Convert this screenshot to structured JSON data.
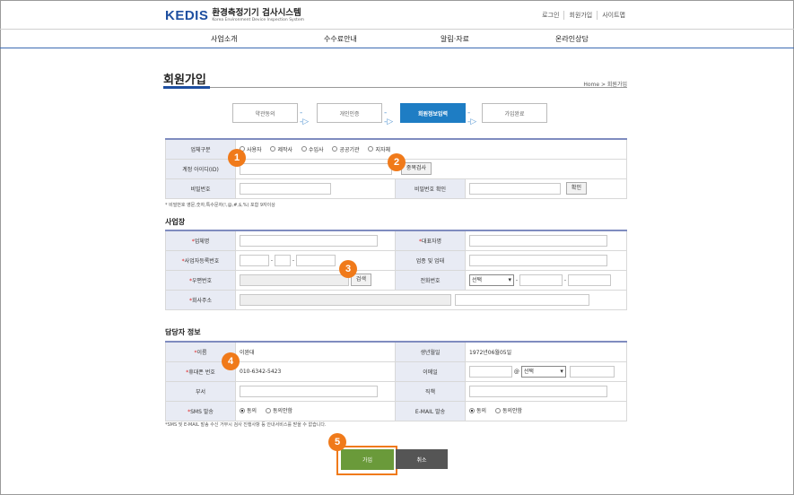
{
  "header": {
    "logo_mark": "KEDIS",
    "logo_kr": "환경측정기기 검사시스템",
    "logo_en": "Korea Environment Device Inspection System",
    "util": [
      "로그인",
      "회원가입",
      "사이트맵"
    ]
  },
  "gnb": [
    "사업소개",
    "수수료안내",
    "알림·자료",
    "온라인상담"
  ],
  "page": {
    "title": "회원가입",
    "breadcrumb": "Home  >  회원가입"
  },
  "steps": [
    "약관동의",
    "개인인증",
    "회원정보입력",
    "가입완료"
  ],
  "account": {
    "biz_type_label": "업체구분",
    "biz_types": [
      "사용자",
      "제작사",
      "수입사",
      "공공기관",
      "지자체"
    ],
    "id_label": "계정 아이디(ID)",
    "dup_check": "중복검사",
    "pw_label": "비밀번호",
    "pw_confirm_label": "비밀번호 확인",
    "confirm_btn": "확인",
    "pw_note": "* 비밀번호 영문,숫자,특수문자(!,@,#,$,%) 포함 9자이상"
  },
  "business": {
    "section_title": "사업장",
    "name_label": "업체명",
    "ceo_label": "대표자명",
    "reg_no_label": "사업자등록번호",
    "industry_label": "업종 및 업태",
    "zip_label": "우편번호",
    "search_btn": "검색",
    "phone_label": "전화번호",
    "phone_select": "선택",
    "addr_label": "회사주소"
  },
  "contact": {
    "section_title": "담당자 정보",
    "name_label": "이름",
    "name_value": "이완대",
    "birth_label": "생년월일",
    "birth_value": "1972년06월05일",
    "mobile_label": "휴대폰 번호",
    "mobile_value": "010-6342-5423",
    "email_label": "이메일",
    "email_select": "선택",
    "dept_label": "부서",
    "position_label": "직책",
    "sms_label": "SMS 발송",
    "email_send_label": "E-MAIL 발송",
    "agree": "동의",
    "disagree": "동의안함",
    "note": "*SMS 및 E-MAIL 발송 수신 거부시 검사 진행사항 등 안내서비스를 받을 수 없습니다."
  },
  "buttons": {
    "join": "가입",
    "cancel": "취소"
  },
  "badges": [
    "1",
    "2",
    "3",
    "4",
    "5"
  ],
  "colors": {
    "brand": "#1e4fa0",
    "accent": "#f07a1a",
    "active_step": "#1e7dc4",
    "join_btn": "#6a9a3a"
  }
}
